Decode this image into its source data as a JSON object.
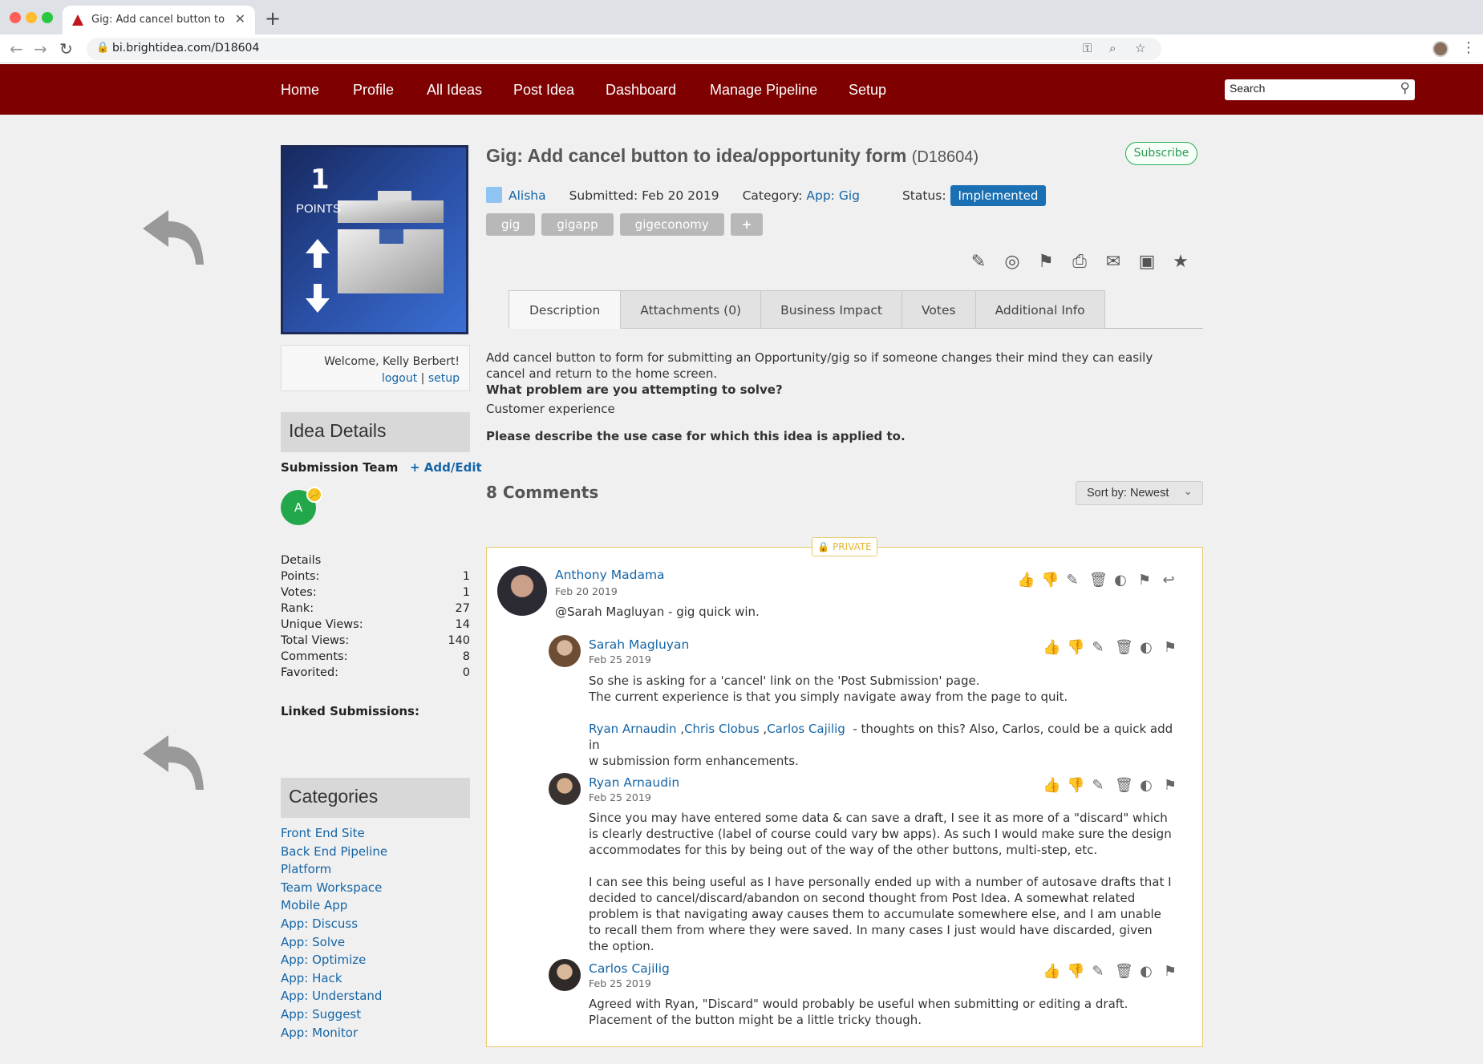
{
  "browser": {
    "tab_title": "Gig: Add cancel button to idea/opportunity form",
    "tab_close": "✕",
    "new_tab": "+",
    "url": "bi.brightidea.com/D18604"
  },
  "nav": {
    "items": [
      "Home",
      "Profile",
      "All Ideas",
      "Post Idea",
      "Dashboard",
      "Manage Pipeline",
      "Setup"
    ],
    "search_placeholder": "Search"
  },
  "idea_image": {
    "points": "1",
    "points_label": "POINTS"
  },
  "welcome": {
    "text": "Welcome, Kelly Berbert!",
    "logout": "logout",
    "separator": "|",
    "setup": "setup"
  },
  "sidebar": {
    "idea_details_title": "Idea Details",
    "submission_team_label": "Submission Team",
    "add_edit": "+ Add/Edit",
    "team_member_initial": "A",
    "details_title": "Details",
    "details": [
      {
        "label": "Points:",
        "value": "1"
      },
      {
        "label": "Votes:",
        "value": "1"
      },
      {
        "label": "Rank:",
        "value": "27"
      },
      {
        "label": "Unique Views:",
        "value": "14"
      },
      {
        "label": "Total Views:",
        "value": "140"
      },
      {
        "label": "Comments:",
        "value": "8"
      },
      {
        "label": "Favorited:",
        "value": "0"
      }
    ],
    "linked_label": "Linked Submissions:",
    "categories_title": "Categories",
    "categories": [
      "Front End Site",
      "Back End Pipeline",
      "Platform",
      "Team Workspace",
      "Mobile App",
      "App: Discuss",
      "App: Solve",
      "App: Optimize",
      "App: Hack",
      "App: Understand",
      "App: Suggest",
      "App: Monitor"
    ]
  },
  "idea": {
    "title": "Gig: Add cancel button to idea/opportunity form",
    "code": "(D18604)",
    "subscribe": "Subscribe",
    "author": "Alisha",
    "submitted": "Submitted: Feb 20 2019",
    "category_label": "Category:",
    "category": "App: Gig",
    "status_label": "Status:",
    "status": "Implemented",
    "status_color": "#1b6fb3",
    "tags": [
      "gig",
      "gigapp",
      "gigeconomy",
      "+"
    ],
    "action_icons": [
      "edit-icon",
      "hide-icon",
      "flag-icon",
      "print-icon",
      "email-icon",
      "twitter-icon",
      "star-icon"
    ]
  },
  "tabs": [
    "Description",
    "Attachments (0)",
    "Business Impact",
    "Votes",
    "Additional Info"
  ],
  "description": {
    "text": "Add cancel button to form for submitting an Opportunity/gig so if someone changes their mind they can easily cancel and return to the home screen.",
    "question1": "What problem are you attempting to solve?",
    "answer1": "Customer experience",
    "question2": "Please describe the use case for which this idea is applied to."
  },
  "comments": {
    "count_label": "8 Comments",
    "sort_label": "Sort by: Newest",
    "private_label": "PRIVATE",
    "items": [
      {
        "name": "Anthony Madama",
        "date": "Feb 20 2019",
        "text": "@Sarah Magluyan - gig quick win."
      },
      {
        "name": "Sarah Magluyan",
        "date": "Feb 25 2019",
        "text1": "So she is asking for a 'cancel' link on the 'Post Submission' page.",
        "text2": "The current experience is that you simply navigate away from the page to quit.",
        "mentions": [
          "Ryan Arnaudin",
          "Chris Clobus",
          "Carlos Cajilig"
        ],
        "mention_sep": ",",
        "text3": "- thoughts on this? Also, Carlos, could be a quick add in",
        "text4": "w submission form enhancements."
      },
      {
        "name": "Ryan Arnaudin",
        "date": "Feb 25 2019",
        "p1": "Since you may have entered some data & can save a draft, I see it as more of a \"discard\" which is clearly destructive (label of course could vary bw apps). As such I would make sure the design accommodates for this by being out of the way of the other buttons, multi-step, etc.",
        "p2": "I can see this being useful as I have personally ended up with a number of autosave drafts that I decided to cancel/discard/abandon on second thought from Post Idea. A somewhat related problem is that navigating away causes them to accumulate somewhere else, and I am unable to recall them from where they were saved. In many cases I just would have discarded, given the option."
      },
      {
        "name": "Carlos Cajilig",
        "date": "Feb 25 2019",
        "text": "Agreed with Ryan, \"Discard\" would probably be useful when submitting or editing a draft. Placement of the button might be a little tricky though."
      }
    ]
  }
}
